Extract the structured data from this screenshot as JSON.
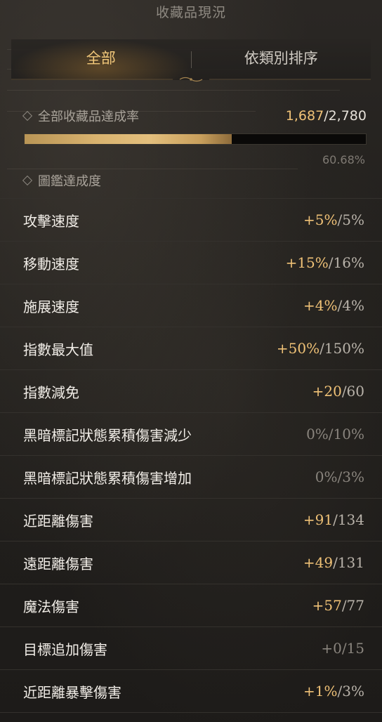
{
  "title": "收藏品現況",
  "tabs": [
    {
      "label": "全部",
      "active": true
    },
    {
      "label": "依類別排序",
      "active": false
    }
  ],
  "overall": {
    "label": "全部收藏品達成率",
    "current": "1,687",
    "separator": "/",
    "total": "2,780",
    "progress_fraction": 0.6068,
    "percent_text": "60.68%"
  },
  "codex": {
    "label": "圖鑑達成度"
  },
  "stats": [
    {
      "label": "攻擊速度",
      "current": "+5%",
      "max": "/5%",
      "active": true
    },
    {
      "label": "移動速度",
      "current": "+15%",
      "max": "/16%",
      "active": true
    },
    {
      "label": "施展速度",
      "current": "+4%",
      "max": "/4%",
      "active": true
    },
    {
      "label": "指數最大值",
      "current": "+50%",
      "max": "/150%",
      "active": true
    },
    {
      "label": "指數減免",
      "current": "+20",
      "max": "/60",
      "active": true
    },
    {
      "label": "黑暗標記狀態累積傷害減少",
      "current": "0%",
      "max": "/10%",
      "active": false
    },
    {
      "label": "黑暗標記狀態累積傷害增加",
      "current": "0%",
      "max": "/3%",
      "active": false
    },
    {
      "label": "近距離傷害",
      "current": "+91",
      "max": "/134",
      "active": true
    },
    {
      "label": "遠距離傷害",
      "current": "+49",
      "max": "/131",
      "active": true
    },
    {
      "label": "魔法傷害",
      "current": "+57",
      "max": "/77",
      "active": true
    },
    {
      "label": "目標追加傷害",
      "current": "+0",
      "max": "/15",
      "active": false
    },
    {
      "label": "近距離暴擊傷害",
      "current": "+1%",
      "max": "/3%",
      "active": true
    }
  ],
  "colors": {
    "accent_gold": "#f0c277",
    "inactive_value": "#8a857e",
    "row_text": "#f2eee8"
  }
}
